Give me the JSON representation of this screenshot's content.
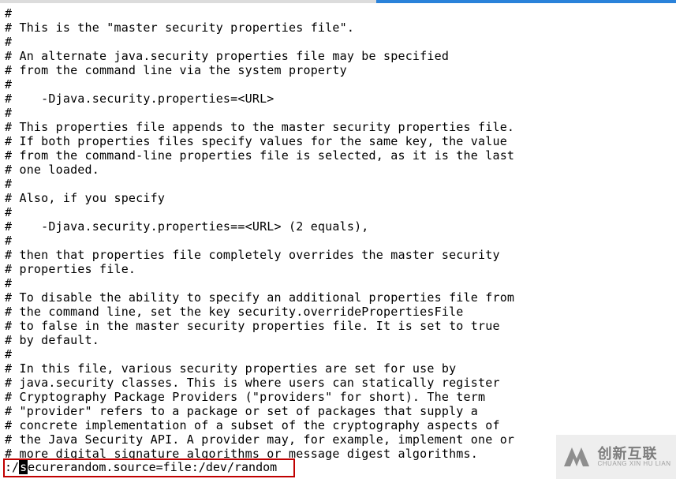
{
  "editor": {
    "lines": [
      "#",
      "# This is the \"master security properties file\".",
      "#",
      "# An alternate java.security properties file may be specified",
      "# from the command line via the system property",
      "#",
      "#    -Djava.security.properties=<URL>",
      "#",
      "# This properties file appends to the master security properties file.",
      "# If both properties files specify values for the same key, the value",
      "# from the command-line properties file is selected, as it is the last",
      "# one loaded.",
      "#",
      "# Also, if you specify",
      "#",
      "#    -Djava.security.properties==<URL> (2 equals),",
      "#",
      "# then that properties file completely overrides the master security",
      "# properties file.",
      "#",
      "# To disable the ability to specify an additional properties file from",
      "# the command line, set the key security.overridePropertiesFile",
      "# to false in the master security properties file. It is set to true",
      "# by default.",
      "#",
      "# In this file, various security properties are set for use by",
      "# java.security classes. This is where users can statically register",
      "# Cryptography Package Providers (\"providers\" for short). The term",
      "# \"provider\" refers to a package or set of packages that supply a",
      "# concrete implementation of a subset of the cryptography aspects of",
      "# the Java Security API. A provider may, for example, implement one or",
      "# more digital signature algorithms or message digest algorithms."
    ],
    "status": {
      "prefix": ":/",
      "cursor_char": "s",
      "rest": "ecurerandom.source=file:/dev/random"
    }
  },
  "watermark": {
    "cn": "创新互联",
    "en": "CHUANG XIN HU LIAN"
  }
}
